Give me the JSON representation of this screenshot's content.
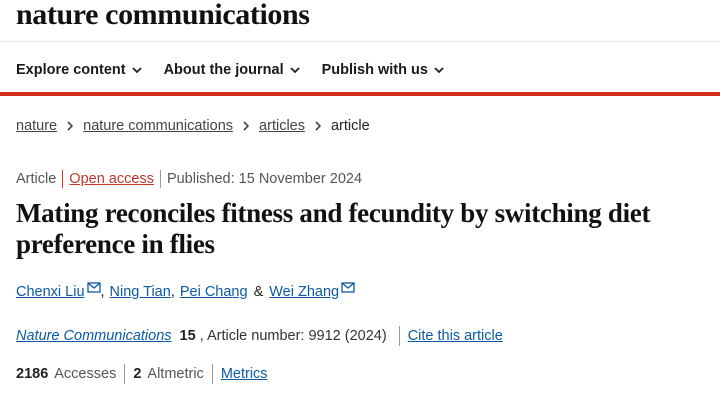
{
  "header": {
    "journal_title": "nature communications",
    "nav": [
      {
        "label": "Explore content"
      },
      {
        "label": "About the journal"
      },
      {
        "label": "Publish with us"
      }
    ]
  },
  "breadcrumb": {
    "items": [
      "nature",
      "nature communications",
      "articles"
    ],
    "current": "article"
  },
  "article": {
    "type": "Article",
    "access": "Open access",
    "published": "Published: 15 November 2024",
    "title": "Mating reconciles fitness and fecundity by switching diet preference in flies",
    "authors": [
      {
        "name": "Chenxi Liu",
        "mail": true
      },
      {
        "name": "Ning Tian",
        "mail": false
      },
      {
        "name": "Pei Chang",
        "mail": false
      },
      {
        "name": "Wei Zhang",
        "mail": true
      }
    ],
    "amp": "&",
    "comma": ",",
    "journal": "Nature Communications",
    "volume": "15",
    "article_number": ", Article number: 9912 (2024)",
    "cite": "Cite this article"
  },
  "metrics": {
    "accesses_value": "2186",
    "accesses_label": "Accesses",
    "altmetric_value": "2",
    "altmetric_label": "Altmetric",
    "metrics_link": "Metrics"
  },
  "colors": {
    "accent_red": "#d42b1e",
    "link_blue": "#0c5aa6",
    "open_access": "#c0392b"
  },
  "icons": [
    "chevron-down-icon",
    "chevron-right-icon",
    "mail-icon"
  ]
}
